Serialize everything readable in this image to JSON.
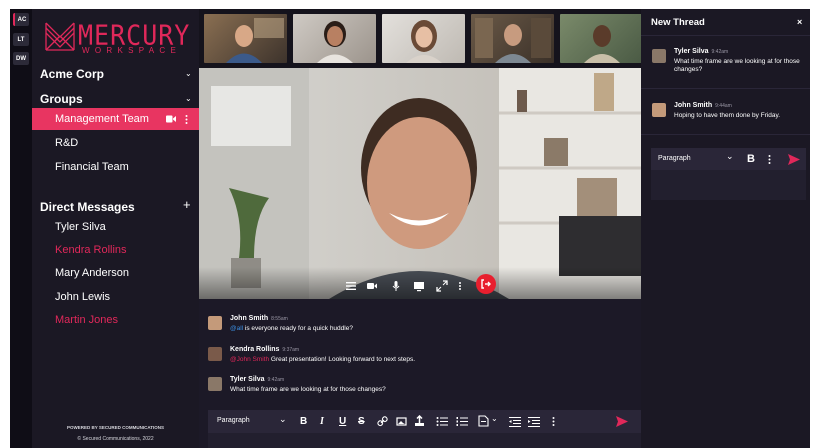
{
  "rail": {
    "workspaces": [
      "AC",
      "LT",
      "DW"
    ]
  },
  "brand": {
    "title": "MERCURY",
    "subtitle": "WORKSPACE"
  },
  "sidebar": {
    "org": "Acme Corp",
    "groups_label": "Groups",
    "groups": [
      {
        "label": "Management Team",
        "selected": true
      },
      {
        "label": "R&D"
      },
      {
        "label": "Financial Team"
      }
    ],
    "dm_label": "Direct Messages",
    "dm_add": "+",
    "dms": [
      {
        "label": "Tyler Silva",
        "highlight": false
      },
      {
        "label": "Kendra Rollins",
        "highlight": true
      },
      {
        "label": "Mary Anderson",
        "highlight": false
      },
      {
        "label": "John Lewis",
        "highlight": false
      },
      {
        "label": "Martin Jones",
        "highlight": true
      }
    ],
    "footer_powered": "POWERED BY SECURED COMMUNICATIONS",
    "footer_copy": "© Secured Communications, 2022"
  },
  "chat": {
    "messages": [
      {
        "name": "John Smith",
        "time": "8:55am",
        "mention": "@all",
        "text": " is everyone ready for a quick huddle?"
      },
      {
        "name": "Kendra Rollins",
        "time": "9:37am",
        "mention": "@John Smith",
        "text": " Great presentation! Looking forward to next steps."
      },
      {
        "name": "Tyler Silva",
        "time": "9:42am",
        "mention": "",
        "text": "What time frame are we looking at for those changes?"
      }
    ],
    "editor": {
      "format": "Paragraph"
    }
  },
  "thread": {
    "title": "New Thread",
    "close": "×",
    "messages": [
      {
        "name": "Tyler Silva",
        "time": "9:42am",
        "text": "What time frame are we looking at for those changes?"
      },
      {
        "name": "John Smith",
        "time": "9:44am",
        "text": "Hoping to have them done by Friday."
      }
    ],
    "editor": {
      "format": "Paragraph",
      "bold": "B"
    }
  },
  "colors": {
    "accent": "#e0285a",
    "background": "#15131c",
    "panel": "#1b1824",
    "leave": "#e81f2e"
  }
}
